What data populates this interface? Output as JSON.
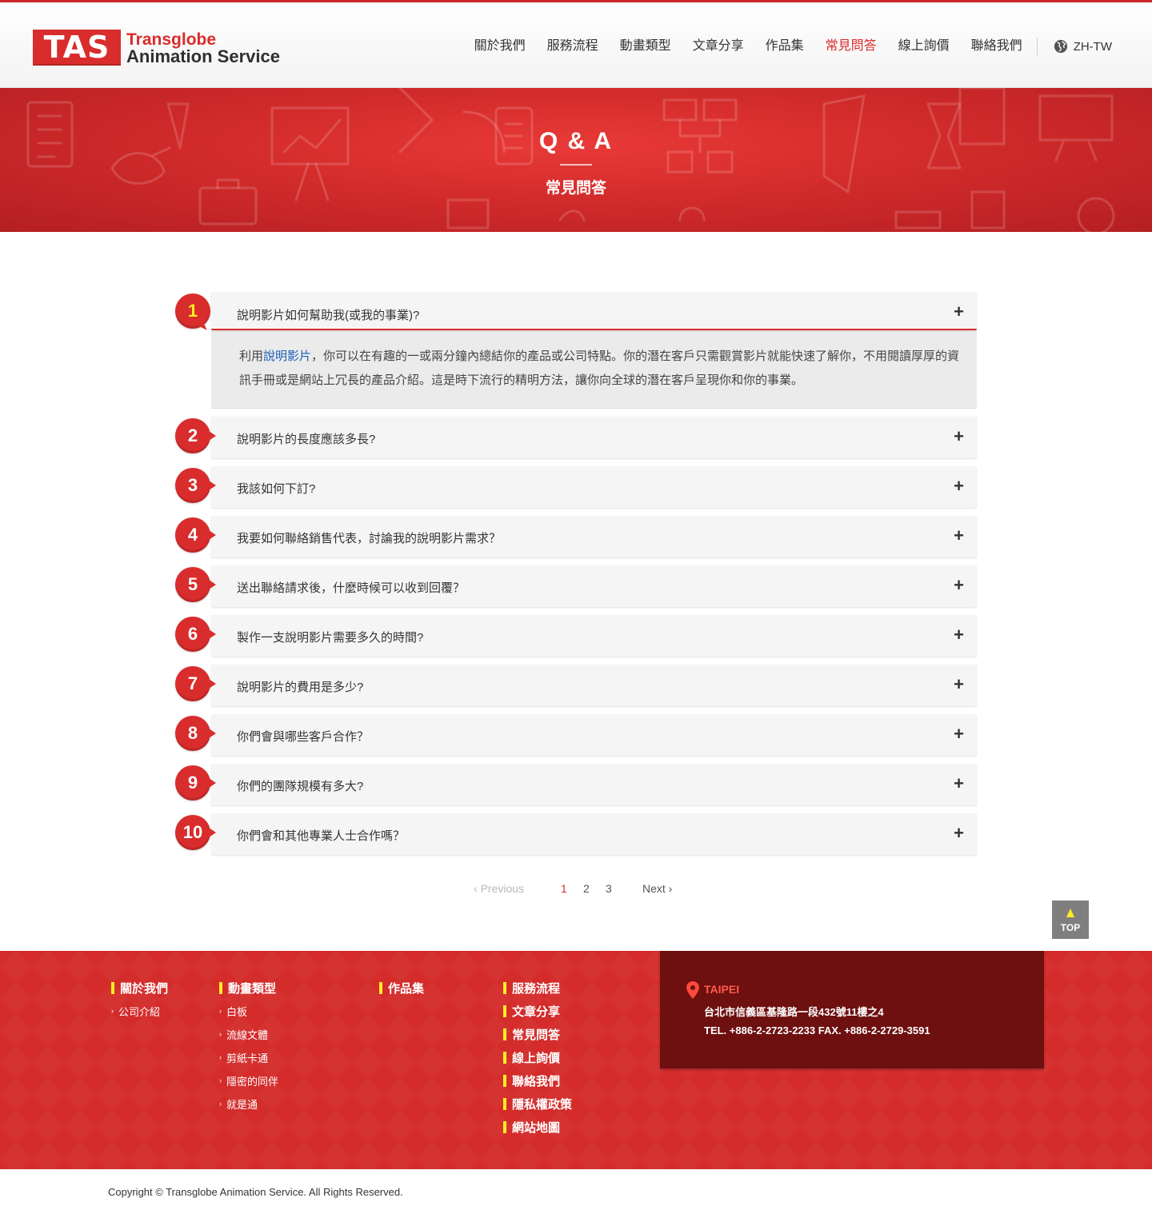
{
  "header": {
    "logo": {
      "mark": "TAS",
      "line1": "Transglobe",
      "line2": "Animation Service"
    },
    "nav": [
      {
        "label": "關於我們",
        "active": false
      },
      {
        "label": "服務流程",
        "active": false
      },
      {
        "label": "動畫類型",
        "active": false
      },
      {
        "label": "文章分享",
        "active": false
      },
      {
        "label": "作品集",
        "active": false
      },
      {
        "label": "常見問答",
        "active": true
      },
      {
        "label": "線上詢價",
        "active": false
      },
      {
        "label": "聯絡我們",
        "active": false
      }
    ],
    "language": {
      "label": "ZH-TW",
      "icon": "globe-icon"
    }
  },
  "banner": {
    "title": "Q & A",
    "subtitle": "常見問答"
  },
  "faq": {
    "items": [
      {
        "num": "1",
        "question": "說明影片如何幫助我(或我的事業)?",
        "open": true,
        "answer": {
          "pre": "利用",
          "link": "說明影片",
          "post": "，你可以在有趣的一或兩分鐘內總結你的產品或公司特點。你的潛在客戶只需觀賞影片就能快速了解你，不用閱讀厚厚的資訊手冊或是網站上冗長的產品介紹。這是時下流行的精明方法，讓你向全球的潛在客戶呈現你和你的事業。"
        }
      },
      {
        "num": "2",
        "question": "說明影片的長度應該多長?"
      },
      {
        "num": "3",
        "question": "我該如何下訂?"
      },
      {
        "num": "4",
        "question": "我要如何聯絡銷售代表，討論我的說明影片需求？"
      },
      {
        "num": "5",
        "question": "送出聯絡請求後，什麼時候可以收到回覆？"
      },
      {
        "num": "6",
        "question": "製作一支說明影片需要多久的時間?"
      },
      {
        "num": "7",
        "question": "說明影片的費用是多少?"
      },
      {
        "num": "8",
        "question": "你們會與哪些客戶合作？"
      },
      {
        "num": "9",
        "question": "你們的團隊規模有多大?"
      },
      {
        "num": "10",
        "question": "你們會和其他專業人士合作嗎？"
      }
    ],
    "toggle_symbol": "+"
  },
  "pagination": {
    "previous": "Previous",
    "next": "Next",
    "pages": [
      "1",
      "2",
      "3"
    ],
    "current": "1"
  },
  "top_button": {
    "label": "TOP"
  },
  "footer": {
    "col1": {
      "title": "關於我們",
      "items": [
        "公司介紹"
      ]
    },
    "col2": {
      "title": "動畫類型",
      "items": [
        "白板",
        "流線文體",
        "剪紙卡通",
        "隱密的同伴",
        "就是通"
      ]
    },
    "col3": {
      "title": "作品集"
    },
    "col4": {
      "items": [
        "服務流程",
        "文章分享",
        "常見問答",
        "線上詢價",
        "聯絡我們",
        "隱私權政策",
        "網站地圖"
      ]
    },
    "contact": {
      "city": "TAIPEI",
      "address": "台北市信義區基隆路一段432號11樓之4",
      "phone_fax": "TEL. +886-2-2723-2233 FAX. +886-2-2729-3591"
    }
  },
  "copyright": "Copyright © Transglobe Animation Service.   All Rights Reserved.",
  "colors": {
    "brand_red": "#d92c2c",
    "highlight_yellow": "#ffee22",
    "footer_dark": "#6e0f10",
    "link_blue": "#1a5fb4"
  }
}
